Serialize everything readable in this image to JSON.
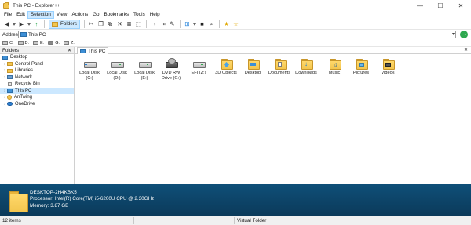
{
  "window": {
    "title": "This PC - Explorer++",
    "minimize": "—",
    "maximize": "☐",
    "close": "✕"
  },
  "menu": [
    "File",
    "Edit",
    "Selection",
    "View",
    "Actions",
    "Go",
    "Bookmarks",
    "Tools",
    "Help"
  ],
  "toolbar": {
    "back_icon": "◀",
    "back_drop": "▾",
    "forward_icon": "▶",
    "forward_drop": "▾",
    "up_icon": "↑",
    "folders_label": "Folders",
    "cut_icon": "✂",
    "copy_icon": "❐",
    "paste_icon": "⧉",
    "delete_icon": "✕",
    "properties_icon": "≣",
    "new_folder_icon": "⬚",
    "copy_to_icon": "⇢",
    "move_to_icon": "⇥",
    "rename_icon": "✎",
    "views_icon": "⊞",
    "views_drop": "▾",
    "cmd_icon": "■",
    "search_icon": "⌕",
    "bookmark_add_icon": "★",
    "bookmarks_icon": "☆"
  },
  "address": {
    "label": "Address",
    "value": "This PC",
    "go_icon": "→",
    "drop": "▾"
  },
  "drives": [
    "C:",
    "D:",
    "E:",
    "G:",
    "Z:"
  ],
  "folders_pane": {
    "title": "Folders",
    "close": "✕",
    "tree": [
      {
        "label": "Desktop",
        "level": 0,
        "icon": "desktop",
        "expander": ""
      },
      {
        "label": "Control Panel",
        "level": 1,
        "icon": "folder",
        "expander": "›"
      },
      {
        "label": "Libraries",
        "level": 1,
        "icon": "folder",
        "expander": "›"
      },
      {
        "label": "Network",
        "level": 1,
        "icon": "network",
        "expander": "›"
      },
      {
        "label": "Recycle Bin",
        "level": 1,
        "icon": "bin",
        "expander": ""
      },
      {
        "label": "This PC",
        "level": 1,
        "icon": "pc",
        "expander": "›",
        "selected": true
      },
      {
        "label": "AnTwing",
        "level": 1,
        "icon": "user",
        "expander": "›"
      },
      {
        "label": "OneDrive",
        "level": 1,
        "icon": "cloud",
        "expander": "›"
      }
    ]
  },
  "tab": {
    "label": "This PC",
    "close": "✕"
  },
  "items": [
    {
      "label": "Local Disk (C:)",
      "icon": "drive-win"
    },
    {
      "label": "Local Disk (D:)",
      "icon": "drive"
    },
    {
      "label": "Local Disk (E:)",
      "icon": "drive"
    },
    {
      "label": "DVD RW Drive (G:)",
      "icon": "dvd"
    },
    {
      "label": "EFI (Z:)",
      "icon": "drive"
    },
    {
      "label": "3D Objects",
      "icon": "folder-3d"
    },
    {
      "label": "Desktop",
      "icon": "folder-desktop"
    },
    {
      "label": "Documents",
      "icon": "folder-documents"
    },
    {
      "label": "Downloads",
      "icon": "folder-downloads"
    },
    {
      "label": "Music",
      "icon": "folder-music"
    },
    {
      "label": "Pictures",
      "icon": "folder-pictures"
    },
    {
      "label": "Videos",
      "icon": "folder-videos"
    }
  ],
  "details": {
    "name": "DESKTOP-2H4KBK5",
    "processor": "Processor: Intel(R) Core(TM) i5-6200U CPU @ 2.30GHz",
    "memory": "Memory: 3.87 GB"
  },
  "status": {
    "items": "12 items",
    "folder": "Virtual Folder"
  },
  "colors": {
    "selection": "#cce8ff",
    "details_bg": "#0f4f78",
    "folder": "#f3c64f",
    "accent": "#3d8fd6"
  }
}
